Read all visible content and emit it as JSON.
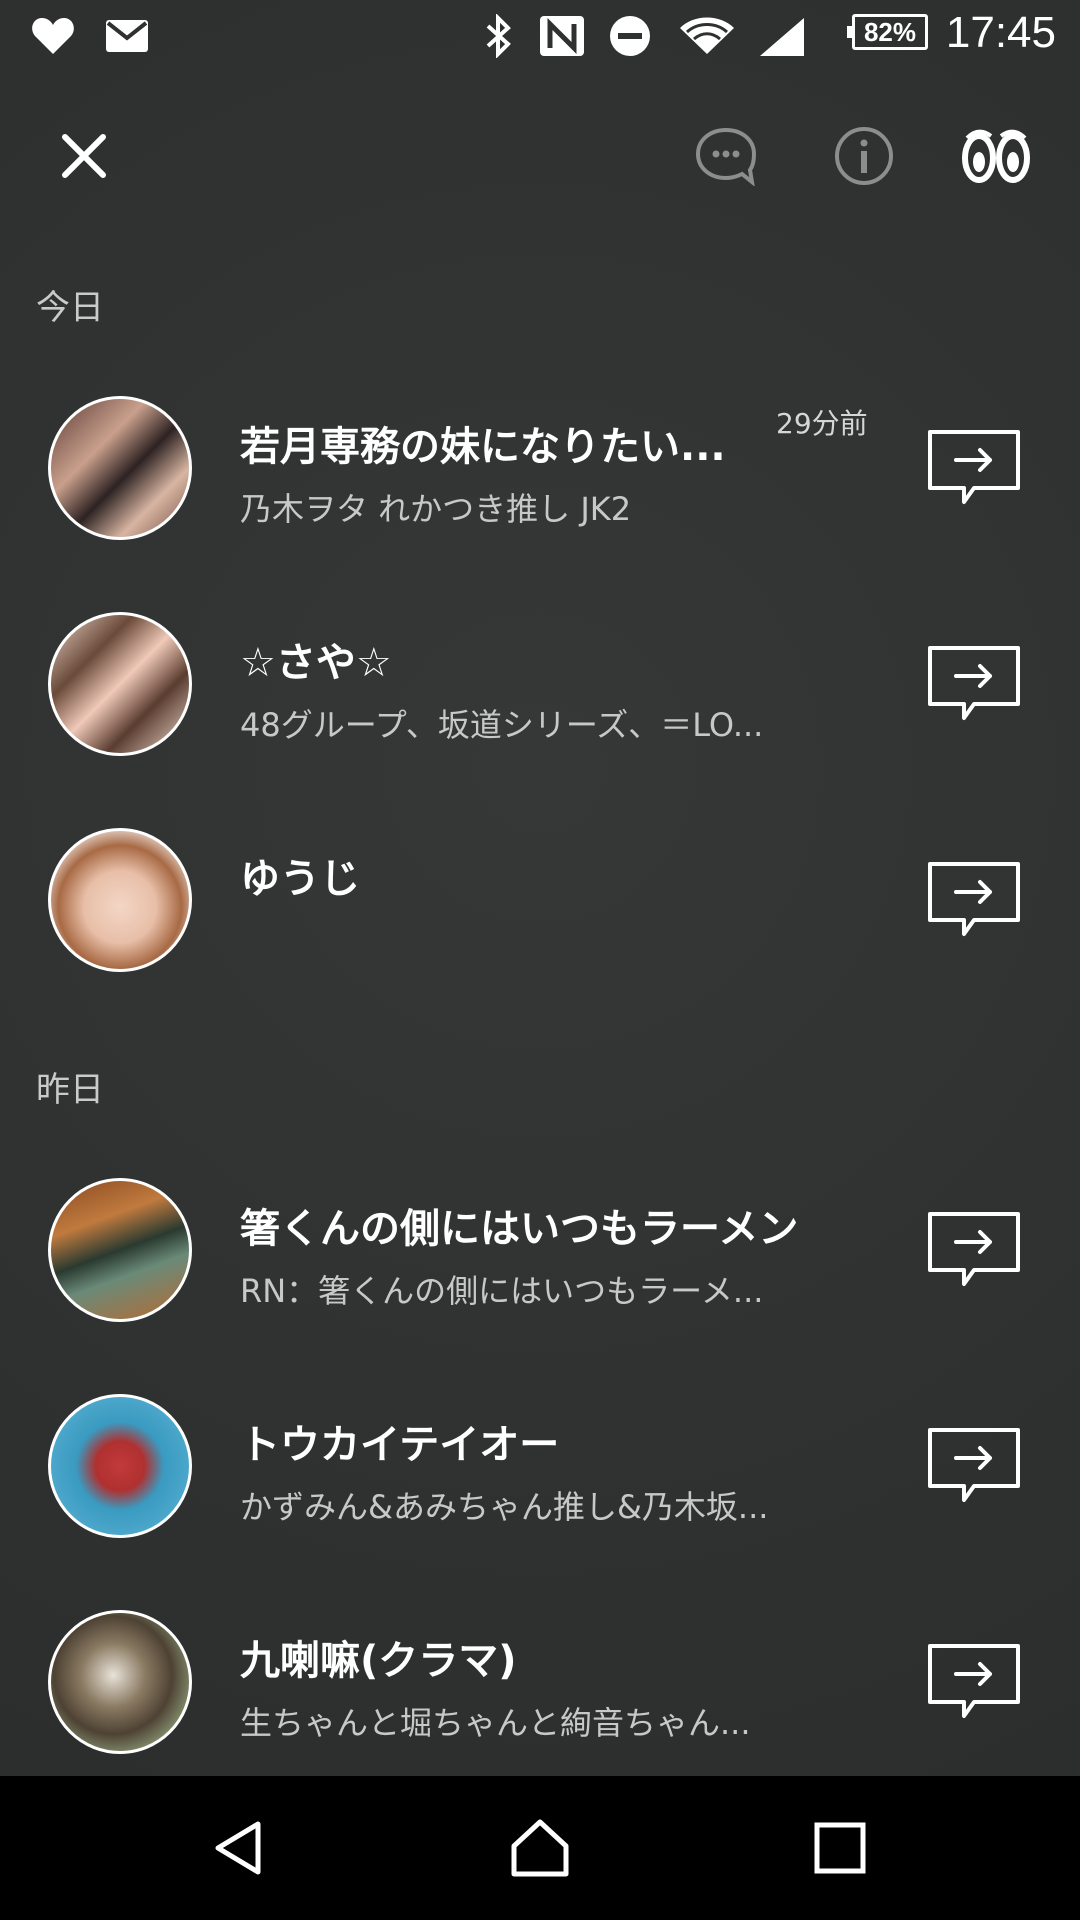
{
  "status_bar": {
    "time": "17:45",
    "battery_percent": "82%",
    "icons": [
      "heart-icon",
      "mail-icon",
      "bluetooth-icon",
      "nfc-icon",
      "do-not-disturb-icon",
      "wifi-icon",
      "signal-icon"
    ]
  },
  "toolbar": {
    "close_icon": "close-icon",
    "chat_icon": "chat-bubble-icon",
    "info_icon": "info-icon",
    "footprints_icon": "footprints-icon"
  },
  "sections": [
    {
      "header": "今日",
      "items": [
        {
          "title": "若月専務の妹になりたい...",
          "subtitle": "乃木ヲタ  れかつき推し  JK2",
          "time": "29分前"
        },
        {
          "title": "☆さや☆",
          "subtitle": "48グループ、坂道シリーズ、＝LO...",
          "time": ""
        },
        {
          "title": "ゆうじ",
          "subtitle": "",
          "time": ""
        }
      ]
    },
    {
      "header": "昨日",
      "items": [
        {
          "title": "箸くんの側にはいつもラーメン",
          "subtitle": "RN：箸くんの側にはいつもラーメ...",
          "time": ""
        },
        {
          "title": "トウカイテイオー",
          "subtitle": "かずみん&あみちゃん推し&乃木坂...",
          "time": ""
        },
        {
          "title": "九喇嘛(クラマ)",
          "subtitle": "生ちゃんと堀ちゃんと絢音ちゃん...",
          "time": ""
        }
      ]
    }
  ],
  "nav": {
    "back_icon": "back-icon",
    "home_icon": "home-icon",
    "recents_icon": "recents-icon"
  },
  "colors": {
    "background": "#2f3131",
    "text_primary": "#ffffff",
    "text_secondary": "#c7c9c9",
    "nav_bar": "#000000"
  }
}
